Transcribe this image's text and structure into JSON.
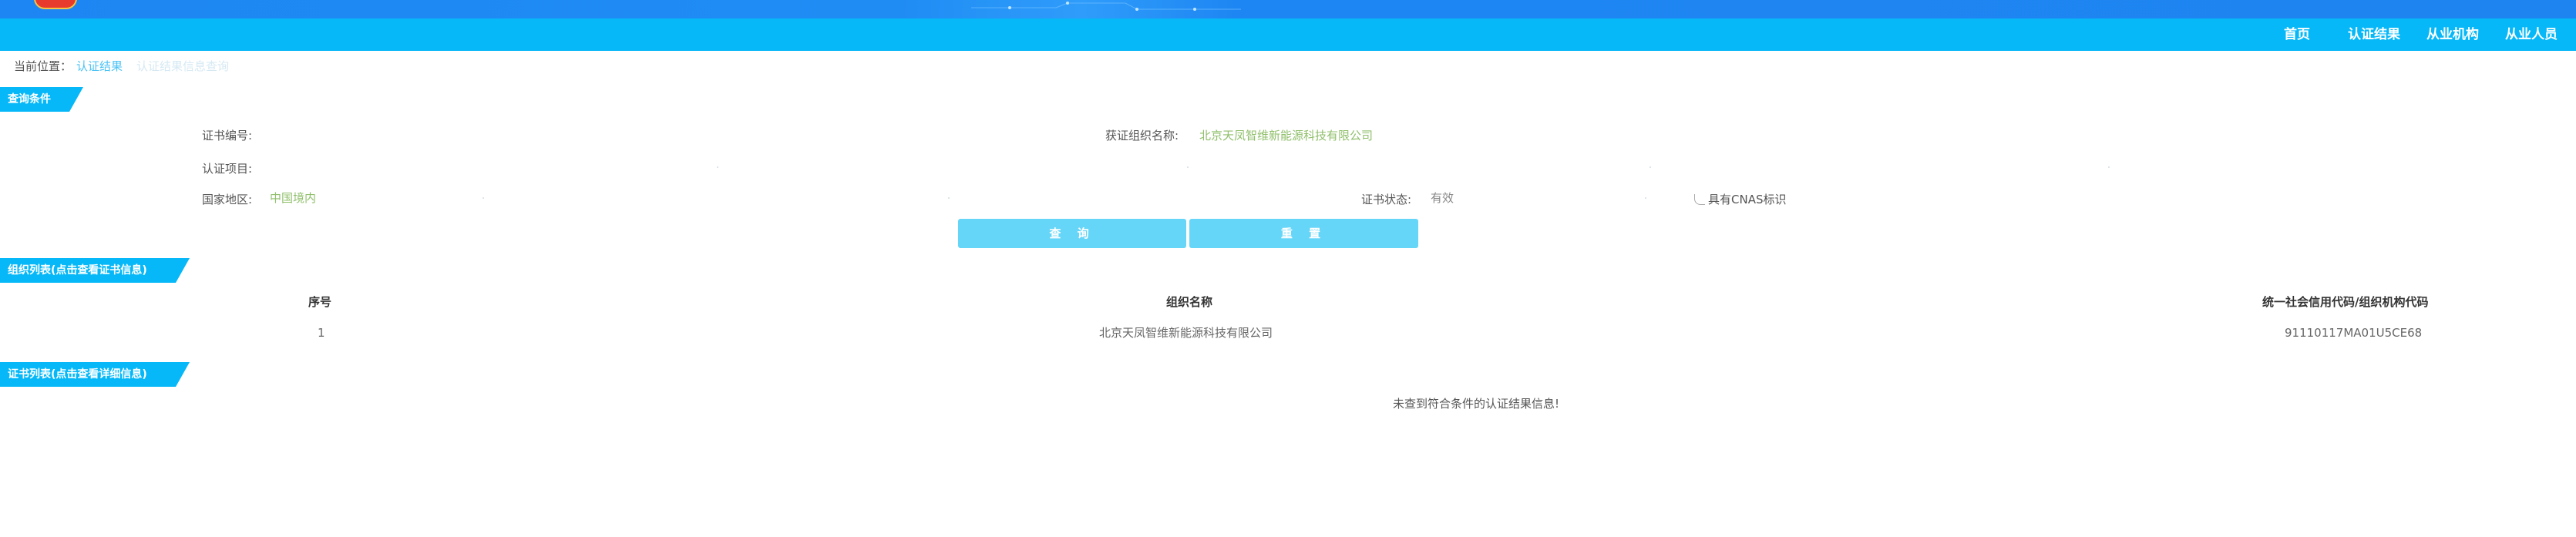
{
  "nav": {
    "items": [
      {
        "label": "首页"
      },
      {
        "label": "认证结果"
      },
      {
        "label": "从业机构"
      },
      {
        "label": "从业人员"
      }
    ]
  },
  "breadcrumb": {
    "label": "当前位置：",
    "items": [
      "认证结果",
      "认证结果信息查询"
    ]
  },
  "query_section": {
    "title": "查询条件",
    "fields": {
      "cert_no_label": "证书编号:",
      "cert_no_value": "",
      "org_name_label": "获证组织名称:",
      "org_name_value": "北京天凤智维新能源科技有限公司",
      "project_label": "认证项目:",
      "project_value": "",
      "region_label": "国家地区:",
      "region_value": "中国境内",
      "status_label": "证书状态:",
      "status_value": "有效",
      "cnas_label": "具有CNAS标识"
    },
    "buttons": {
      "query_label": "查 询",
      "reset_label": "重 置"
    }
  },
  "org_section": {
    "title": "组织列表(点击查看证书信息)",
    "columns": [
      "序号",
      "组织名称",
      "统一社会信用代码/组织机构代码"
    ],
    "rows": [
      [
        "1",
        "北京天凤智维新能源科技有限公司",
        "91110117MA01U5CE68"
      ]
    ]
  },
  "cert_section": {
    "title": "证书列表(点击查看详细信息)",
    "empty_message": "未查到符合条件的认证结果信息!"
  },
  "colors": {
    "nav_bg": "#06b8f8",
    "banner_bg": "#1e86f2",
    "button_bg": "#66d6f8",
    "link": "#4cc3f5"
  }
}
